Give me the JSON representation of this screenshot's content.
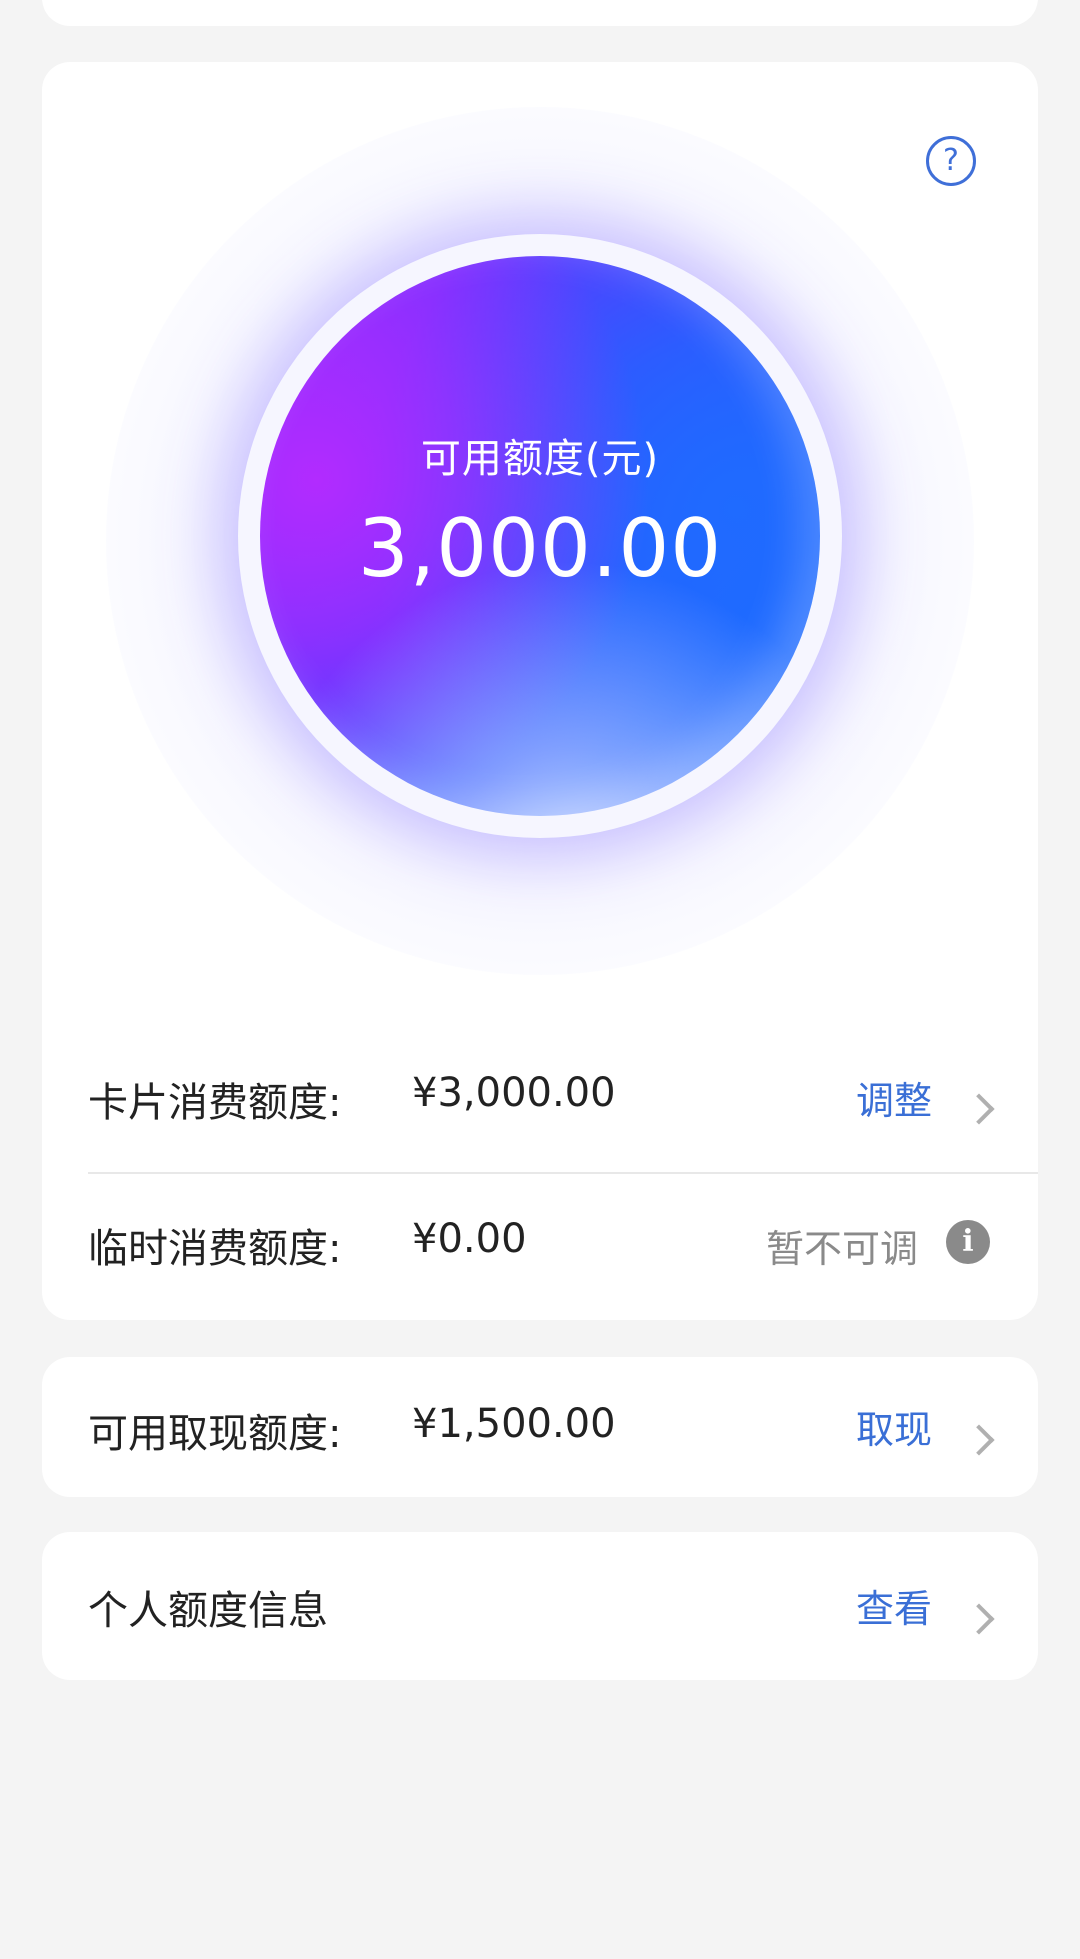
{
  "help_icon": "question-icon",
  "circle": {
    "label": "可用额度(元)",
    "amount": "3,000.00"
  },
  "card_limit": {
    "label": "卡片消费额度:",
    "value": "¥3,000.00",
    "action": "调整"
  },
  "temp_limit": {
    "label": "临时消费额度:",
    "value": "¥0.00",
    "action": "暂不可调",
    "icon": "info-icon"
  },
  "cash_limit": {
    "label": "可用取现额度:",
    "value": "¥1,500.00",
    "action": "取现"
  },
  "personal_info": {
    "label": "个人额度信息",
    "action": "查看"
  },
  "colors": {
    "accent": "#3a6fd6",
    "muted": "#8a8a8a",
    "orb_purple": "#b22bff",
    "orb_blue": "#1c66ff"
  }
}
